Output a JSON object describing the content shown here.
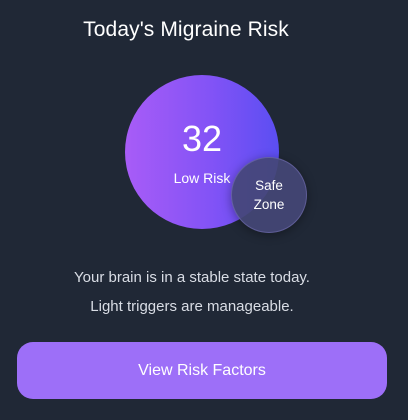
{
  "header": {
    "title": "Today's Migraine Risk"
  },
  "risk": {
    "score": "32",
    "level": "Low Risk",
    "zone_line1": "Safe",
    "zone_line2": "Zone"
  },
  "message": {
    "line1": "Your brain is in a stable state today.",
    "line2": "Light triggers are manageable."
  },
  "actions": {
    "view_factors_label": "View Risk Factors"
  },
  "colors": {
    "background": "#202836",
    "orb_gradient_start": "#a85cf7",
    "orb_gradient_end": "#5b4ef2",
    "button": "#9d6ff8"
  }
}
